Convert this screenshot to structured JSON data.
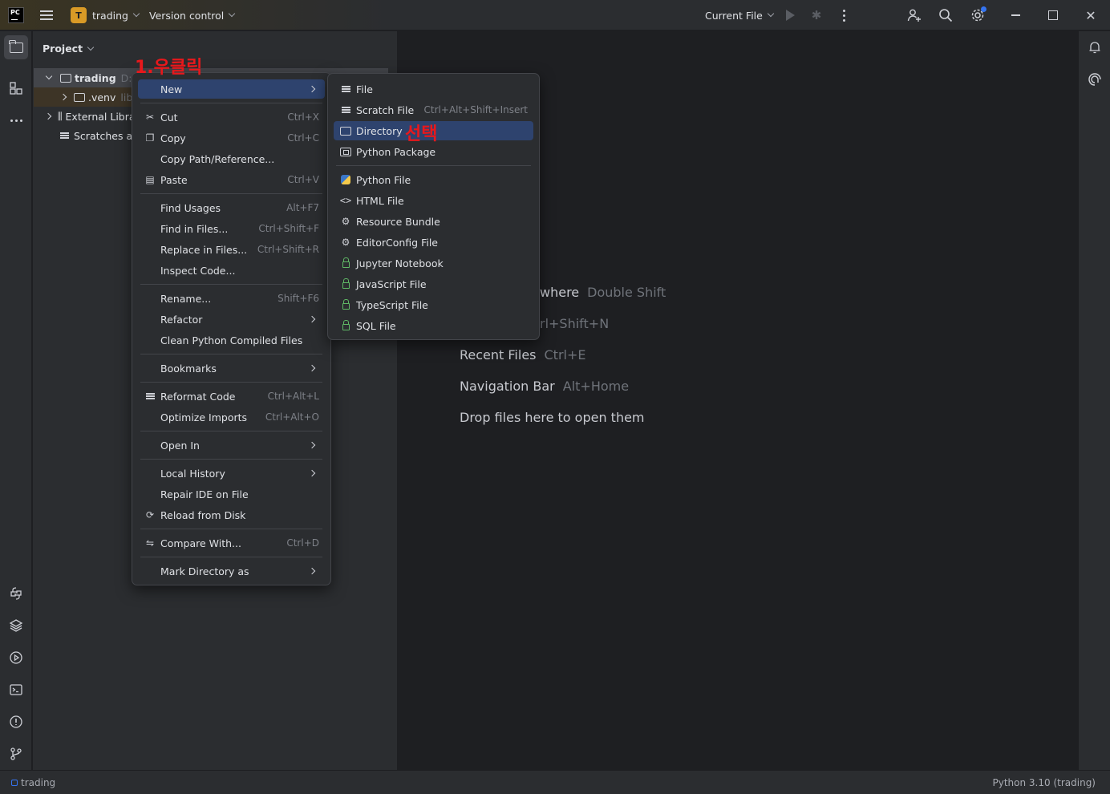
{
  "titlebar": {
    "project_initial": "T",
    "project_name": "trading",
    "version_control": "Version control",
    "run_config": "Current File"
  },
  "project_panel": {
    "title": "Project",
    "tree": [
      {
        "label": "trading",
        "hint": "D:#"
      },
      {
        "label": ".venv",
        "hint": "libr"
      },
      {
        "label": "External Libra"
      },
      {
        "label": "Scratches and"
      }
    ]
  },
  "editor_hints": [
    {
      "label": "where",
      "shortcut": "Double Shift"
    },
    {
      "label": "",
      "shortcut": "rl+Shift+N"
    },
    {
      "label": "Recent Files",
      "shortcut": "Ctrl+E"
    },
    {
      "label": "Navigation Bar",
      "shortcut": "Alt+Home"
    },
    {
      "label": "Drop files here to open them",
      "shortcut": ""
    }
  ],
  "context_menu": {
    "items": [
      {
        "label": "New",
        "shortcut": ""
      },
      {
        "label": "Cut",
        "shortcut": "Ctrl+X"
      },
      {
        "label": "Copy",
        "shortcut": "Ctrl+C"
      },
      {
        "label": "Copy Path/Reference...",
        "shortcut": ""
      },
      {
        "label": "Paste",
        "shortcut": "Ctrl+V"
      },
      {
        "label": "Find Usages",
        "shortcut": "Alt+F7"
      },
      {
        "label": "Find in Files...",
        "shortcut": "Ctrl+Shift+F"
      },
      {
        "label": "Replace in Files...",
        "shortcut": "Ctrl+Shift+R"
      },
      {
        "label": "Inspect Code...",
        "shortcut": ""
      },
      {
        "label": "Rename...",
        "shortcut": "Shift+F6"
      },
      {
        "label": "Refactor",
        "shortcut": ""
      },
      {
        "label": "Clean Python Compiled Files",
        "shortcut": ""
      },
      {
        "label": "Bookmarks",
        "shortcut": ""
      },
      {
        "label": "Reformat Code",
        "shortcut": "Ctrl+Alt+L"
      },
      {
        "label": "Optimize Imports",
        "shortcut": "Ctrl+Alt+O"
      },
      {
        "label": "Open In",
        "shortcut": ""
      },
      {
        "label": "Local History",
        "shortcut": ""
      },
      {
        "label": "Repair IDE on File",
        "shortcut": ""
      },
      {
        "label": "Reload from Disk",
        "shortcut": ""
      },
      {
        "label": "Compare With...",
        "shortcut": "Ctrl+D"
      },
      {
        "label": "Mark Directory as",
        "shortcut": ""
      }
    ]
  },
  "new_submenu": {
    "items": [
      {
        "label": "File",
        "shortcut": ""
      },
      {
        "label": "Scratch File",
        "shortcut": "Ctrl+Alt+Shift+Insert"
      },
      {
        "label": "Directory",
        "shortcut": ""
      },
      {
        "label": "Python Package",
        "shortcut": ""
      },
      {
        "label": "Python File",
        "shortcut": ""
      },
      {
        "label": "HTML File",
        "shortcut": ""
      },
      {
        "label": "Resource Bundle",
        "shortcut": ""
      },
      {
        "label": "EditorConfig File",
        "shortcut": ""
      },
      {
        "label": "Jupyter Notebook",
        "shortcut": ""
      },
      {
        "label": "JavaScript File",
        "shortcut": ""
      },
      {
        "label": "TypeScript File",
        "shortcut": ""
      },
      {
        "label": "SQL File",
        "shortcut": ""
      }
    ]
  },
  "annotations": {
    "right_click": "1.우클릭",
    "select": "선택"
  },
  "statusbar": {
    "project": "trading",
    "interpreter": "Python 3.10 (trading)"
  },
  "colors": {
    "accent": "#3574f0",
    "highlight": "#2e436e",
    "annotation": "#e8181c",
    "project_badge": "#d99a26"
  }
}
